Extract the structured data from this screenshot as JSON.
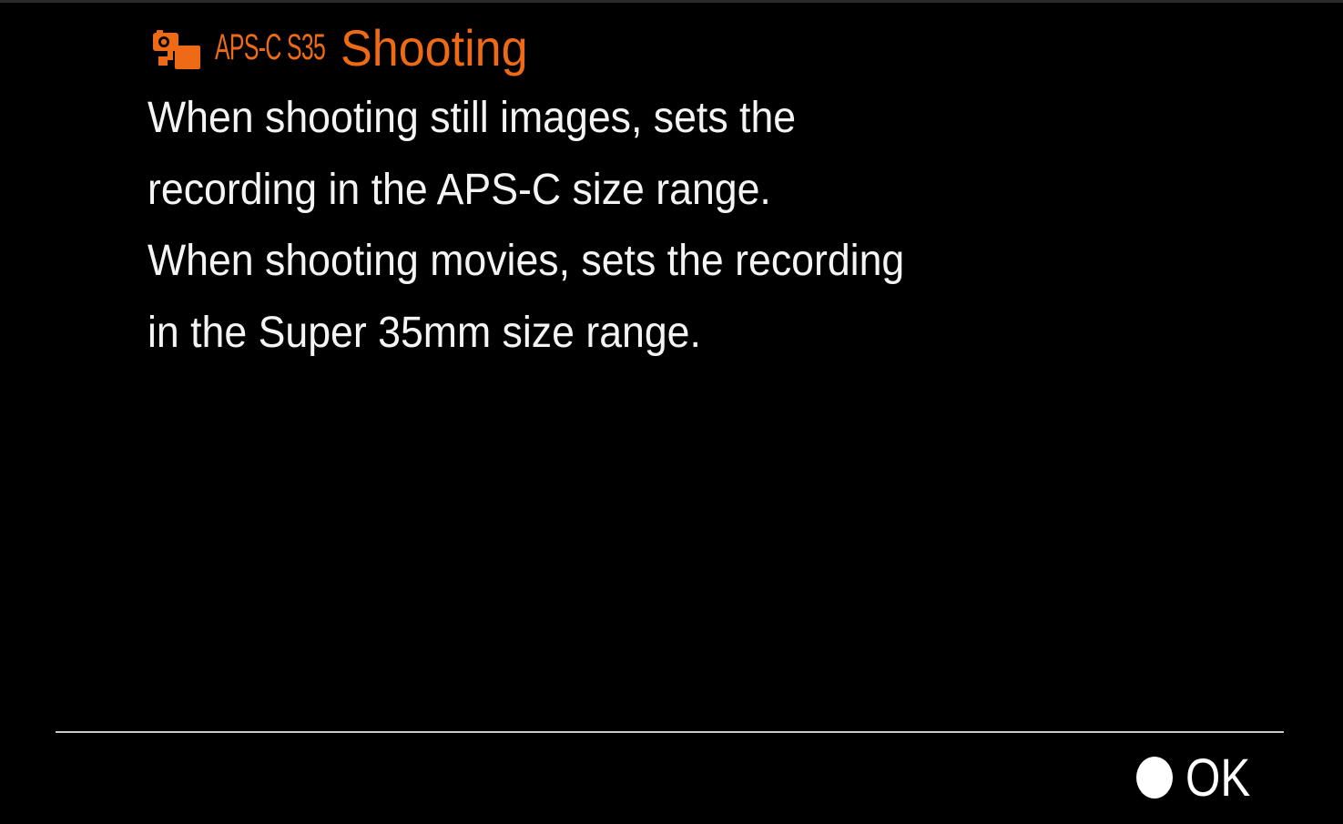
{
  "header": {
    "icon": "camera-shoot-icon",
    "mode_tag": "APS-C S35",
    "title": "Shooting",
    "accent_color": "#ee6a16"
  },
  "description": {
    "lines": [
      "When shooting still images, sets the",
      "recording in the APS-C size range.",
      "When shooting movies, sets the recording",
      "in the Super 35mm size range."
    ]
  },
  "footer": {
    "button_icon": "circle-button-icon",
    "ok_label": "OK"
  }
}
